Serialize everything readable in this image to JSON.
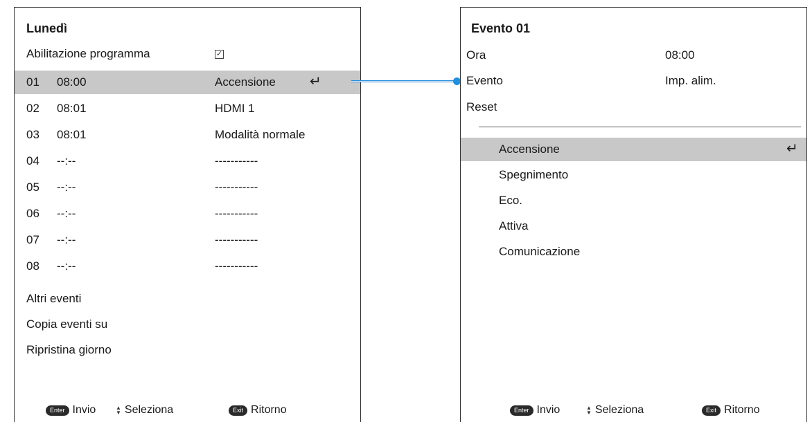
{
  "left_panel": {
    "title": "Lunedì",
    "enable_label": "Abilitazione programma",
    "enable_checked": "✓",
    "events": [
      {
        "num": "01",
        "time": "08:00",
        "action": "Accensione"
      },
      {
        "num": "02",
        "time": "08:01",
        "action": "HDMI 1"
      },
      {
        "num": "03",
        "time": "08:01",
        "action": "Modalità normale"
      },
      {
        "num": "04",
        "time": "--:--",
        "action": "-----------"
      },
      {
        "num": "05",
        "time": "--:--",
        "action": "-----------"
      },
      {
        "num": "06",
        "time": "--:--",
        "action": "-----------"
      },
      {
        "num": "07",
        "time": "--:--",
        "action": "-----------"
      },
      {
        "num": "08",
        "time": "--:--",
        "action": "-----------"
      }
    ],
    "selected_event": "01",
    "enter_symbol": "↵",
    "menu": [
      "Altri eventi",
      "Copia eventi su",
      "Ripristina giorno"
    ],
    "footer": {
      "enter_key": "Enter",
      "enter_label": "Invio",
      "select_label": "Seleziona",
      "exit_key": "Exit",
      "exit_label": "Ritorno"
    }
  },
  "right_panel": {
    "title": "Evento 01",
    "fields": [
      {
        "label": "Ora",
        "value": "08:00"
      },
      {
        "label": "Evento",
        "value": "Imp. alim."
      },
      {
        "label": "Reset",
        "value": ""
      }
    ],
    "options": [
      "Accensione",
      "Spegnimento",
      "Eco.",
      "Attiva",
      "Comunicazione"
    ],
    "selected_option": "Accensione",
    "enter_symbol": "↵",
    "footer": {
      "enter_key": "Enter",
      "enter_label": "Invio",
      "select_label": "Seleziona",
      "exit_key": "Exit",
      "exit_label": "Ritorno"
    }
  },
  "colors": {
    "selection": "#c8c8c8",
    "connector": "#1f8fe0"
  }
}
